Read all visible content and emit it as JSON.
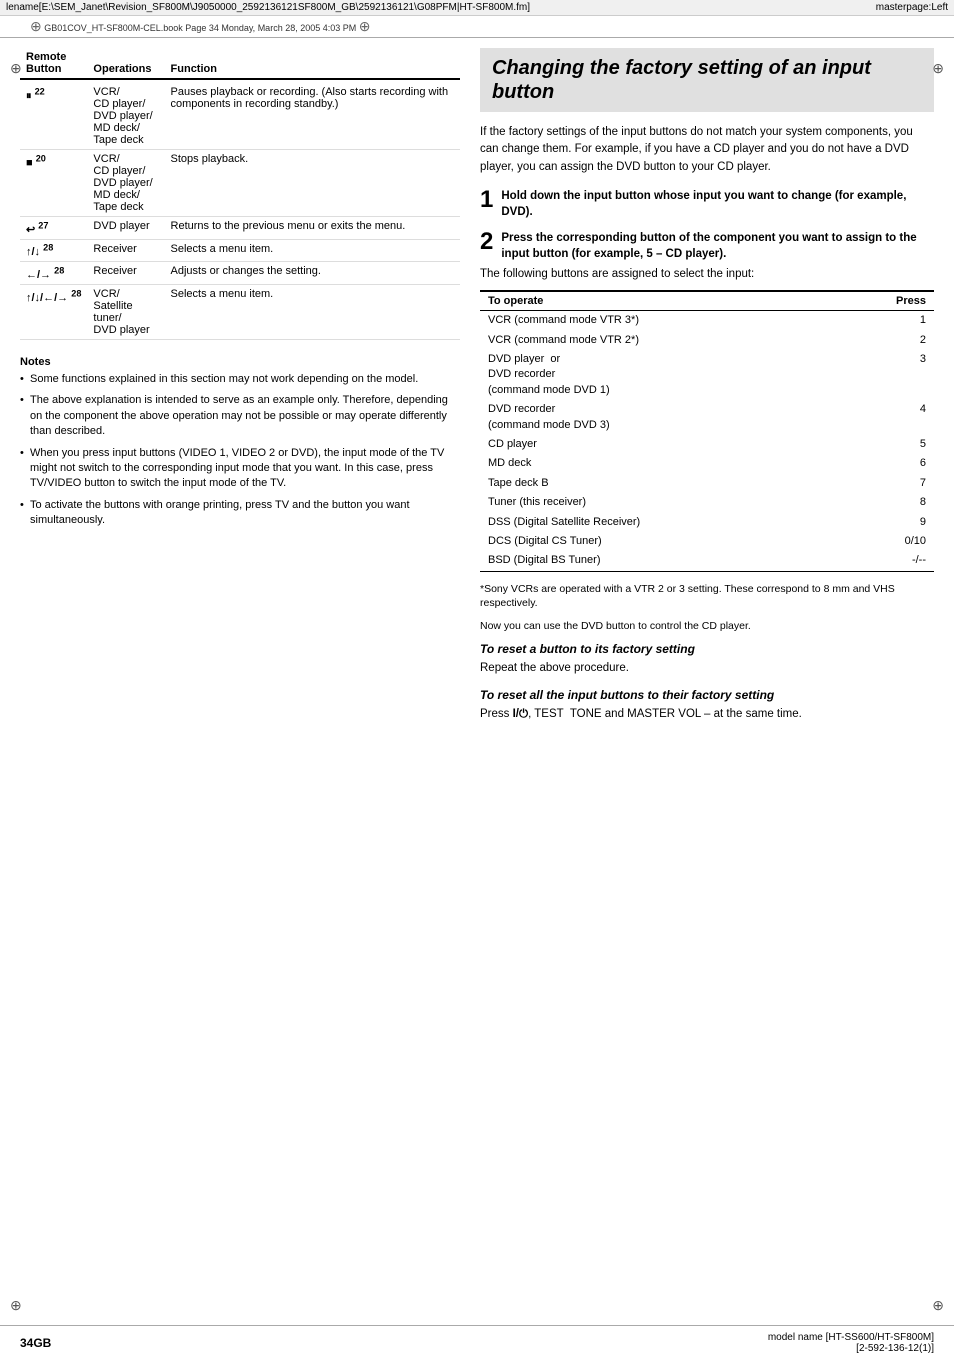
{
  "header": {
    "filename": "lename[E:\\SEM_Janet\\Revision_SF800M\\J9050000_2592136121SF800M_GB\\2592136121\\G08PFM|HT-SF800M.fm]",
    "masterpage": "masterpage:Left"
  },
  "bookinfo": {
    "text": "GB01COV_HT-SF800M-CEL.book  Page 34  Monday, March 28, 2005  4:03 PM"
  },
  "left_column": {
    "table": {
      "headers": [
        "Remote Button",
        "Operations",
        "Function"
      ],
      "rows": [
        {
          "button": "⏸ 22",
          "operations": "VCR/\nCD player/\nDVD player/\nMD deck/\nTape deck",
          "function": "Pauses playback or recording. (Also starts recording with components in recording standby.)"
        },
        {
          "button": "■ 20",
          "operations": "VCR/\nCD player/\nDVD player/\nMD deck/\nTape deck",
          "function": "Stops playback."
        },
        {
          "button": "↩ 27",
          "operations": "DVD player",
          "function": "Returns to the previous menu or exits the menu."
        },
        {
          "button": "↑/↓ 28",
          "operations": "Receiver",
          "function": "Selects a menu item."
        },
        {
          "button": "←/→ 28",
          "operations": "Receiver",
          "function": "Adjusts or changes the setting."
        },
        {
          "button": "↑/↓/←/→ 28",
          "operations": "VCR/\nSatellite tuner/\nDVD player",
          "function": "Selects a menu item."
        }
      ]
    },
    "notes": {
      "title": "Notes",
      "items": [
        "Some functions explained in this section may not work depending on the model.",
        "The above explanation is intended to serve as an example only. Therefore, depending on the component the above operation may not be possible or may operate differently than described.",
        "When you press input buttons (VIDEO 1, VIDEO 2 or DVD), the input mode of the TV might not switch to the corresponding input mode that you want. In this case, press TV/VIDEO button to switch the input mode of the TV.",
        "To activate the buttons with orange printing, press TV and the button you want simultaneously."
      ]
    }
  },
  "right_column": {
    "section_title": "Changing the factory setting of an input button",
    "intro_text": "If the factory settings of the input buttons do not match your system components, you can change them. For example, if you have a CD player and you do not have a DVD player, you can assign the DVD button to your CD player.",
    "step1": {
      "number": "1",
      "text": "Hold down the input button whose input you want to change (for example, DVD)."
    },
    "step2": {
      "number": "2",
      "text": "Press the corresponding button of the component you want to assign to the input button (for example, 5 – CD player).",
      "intro": "The following buttons are assigned to select the input:",
      "table": {
        "headers": [
          "To operate",
          "Press"
        ],
        "rows": [
          {
            "operation": "VCR (command mode VTR 3*)",
            "press": "1"
          },
          {
            "operation": "VCR (command mode VTR 2*)",
            "press": "2"
          },
          {
            "operation": "DVD player  or\nDVD recorder\n(command mode DVD 1)",
            "press": "3"
          },
          {
            "operation": "DVD recorder\n(command mode DVD 3)",
            "press": "4"
          },
          {
            "operation": "CD player",
            "press": "5"
          },
          {
            "operation": "MD deck",
            "press": "6"
          },
          {
            "operation": "Tape deck B",
            "press": "7"
          },
          {
            "operation": "Tuner (this receiver)",
            "press": "8"
          },
          {
            "operation": "DSS (Digital Satellite Receiver)",
            "press": "9"
          },
          {
            "operation": "DCS (Digital CS Tuner)",
            "press": "0/10"
          },
          {
            "operation": "BSD (Digital BS Tuner)",
            "press": "-/--"
          }
        ]
      }
    },
    "footnote": "*Sony VCRs are operated with a VTR 2 or 3 setting. These correspond to 8 mm and VHS respectively.",
    "after_table_text": "Now you can use the DVD button to control the CD player.",
    "reset_single": {
      "title": "To reset a button to its factory setting",
      "text": "Repeat the above procedure."
    },
    "reset_all": {
      "title": "To reset all the input buttons to their factory setting",
      "text": "Press I/⏻, TEST  TONE and MASTER VOL – at the same time."
    }
  },
  "footer": {
    "page_number": "34GB",
    "model_name": "model name [HT-SS600/HT-SF800M]",
    "model_code": "[2-592-136-12(1)]"
  }
}
